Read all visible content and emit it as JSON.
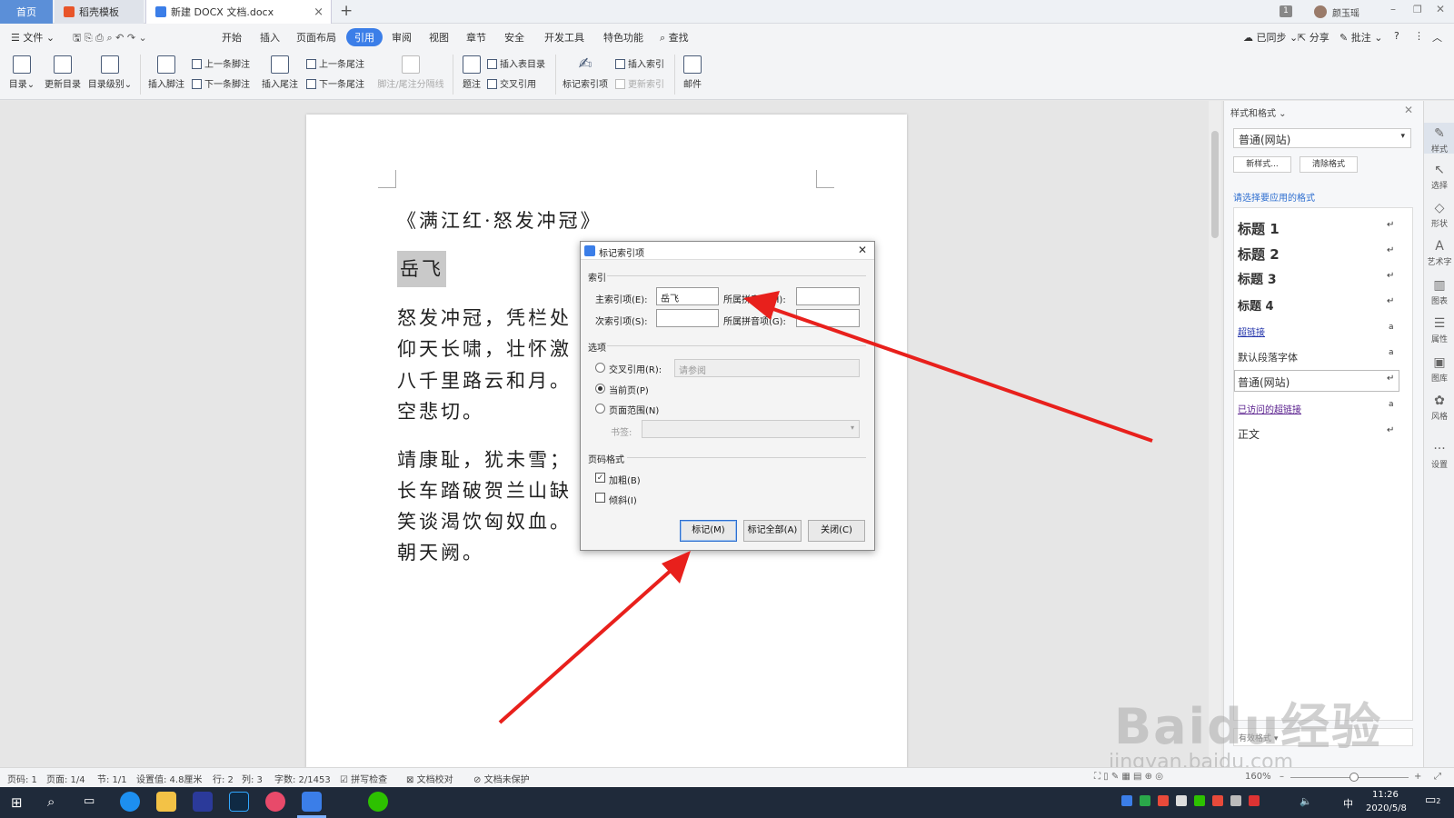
{
  "tabs": {
    "home": "首页",
    "template": "稻壳模板",
    "document": "新建 DOCX 文档.docx",
    "new_tab": "+",
    "close": "×"
  },
  "user": {
    "name": "颜玉瑶",
    "badge": "1"
  },
  "menu": {
    "file": "文件",
    "items": [
      "开始",
      "插入",
      "页面布局",
      "引用",
      "审阅",
      "视图",
      "章节",
      "安全",
      "开发工具",
      "特色功能"
    ],
    "search": "查找",
    "active": "引用",
    "sync": "已同步",
    "share": "分享",
    "comment": "批注",
    "help": "?"
  },
  "ribbon": {
    "toc": "目录",
    "update_toc": "更新目录",
    "toc_level": "目录级别",
    "insert_footnote": "插入脚注",
    "prev_footnote": "上一条脚注",
    "next_footnote": "下一条脚注",
    "insert_endnote": "插入尾注",
    "prev_endnote": "上一条尾注",
    "next_endnote": "下一条尾注",
    "separator": "脚注/尾注分隔线",
    "caption": "题注",
    "insert_table_toc": "插入表目录",
    "cross_ref": "交叉引用",
    "mark_index": "标记索引项",
    "insert_index": "插入索引",
    "update_index": "更新索引",
    "mail": "邮件"
  },
  "document": {
    "title": "《满江红·怒发冲冠》",
    "author": "岳飞",
    "lines": [
      "怒发冲冠，凭栏处",
      "仰天长啸，壮怀激",
      "八千里路云和月。",
      "空悲切。",
      "靖康耻，犹未雪；",
      "长车踏破贺兰山缺",
      "笑谈渴饮匈奴血。",
      "朝天阙。"
    ]
  },
  "dialog": {
    "title": "标记索引项",
    "group_index": "索引",
    "main_entry_label": "主索引项(E):",
    "main_entry_value": "岳飞",
    "main_pinyin_label": "所属拼音项(H):",
    "sub_entry_label": "次索引项(S):",
    "sub_pinyin_label": "所属拼音项(G):",
    "group_options": "选项",
    "opt_cross_ref": "交叉引用(R):",
    "cross_ref_placeholder": "请参阅",
    "opt_current_page": "当前页(P)",
    "opt_page_range": "页面范围(N)",
    "bookmark_label": "书签:",
    "group_page_format": "页码格式",
    "bold": "加粗(B)",
    "italic": "倾斜(I)",
    "btn_mark": "标记(M)",
    "btn_mark_all": "标记全部(A)",
    "btn_close": "关闭(C)",
    "bold_checked": true,
    "italic_checked": false
  },
  "panel": {
    "title": "样式和格式",
    "current_style": "普通(网站)",
    "new_style": "新样式...",
    "clear_format": "清除格式",
    "prompt": "请选择要应用的格式",
    "styles": [
      {
        "name": "标题 1",
        "mark": "↵"
      },
      {
        "name": "标题 2",
        "mark": "↵"
      },
      {
        "name": "标题 3",
        "mark": "↵"
      },
      {
        "name": "标题 4",
        "mark": "↵"
      },
      {
        "name": "超链接",
        "mark": "a"
      },
      {
        "name": "默认段落字体",
        "mark": "a"
      },
      {
        "name": "普通(网站)",
        "mark": "↵"
      },
      {
        "name": "已访问的超链接",
        "mark": "a"
      },
      {
        "name": "正文",
        "mark": "↵"
      }
    ],
    "show_label": "有效格式"
  },
  "sidebar": [
    "样式",
    "选择",
    "形状",
    "艺术字",
    "图表",
    "属性",
    "图库",
    "风格",
    "设置"
  ],
  "status": {
    "page": "页码: 1",
    "pages": "页面: 1/4",
    "section": "节: 1/1",
    "setting": "设置值: 4.8厘米",
    "row": "行: 2",
    "col": "列: 3",
    "words": "字数: 2/1453",
    "spell": "拼写检查",
    "proof": "文档校对",
    "protect": "文档未保护",
    "zoom": "160%"
  },
  "taskbar": {
    "time": "11:26",
    "date": "2020/5/8",
    "ime": "中",
    "notif": "2"
  },
  "watermark": {
    "brand": "Baidu经验",
    "url": "jingyan.baidu.com"
  },
  "colors": {
    "accent": "#3b7ee8",
    "home_tab": "#5b8fd8",
    "arrow": "#e8201c",
    "taskbar": "#1f2a3a"
  }
}
